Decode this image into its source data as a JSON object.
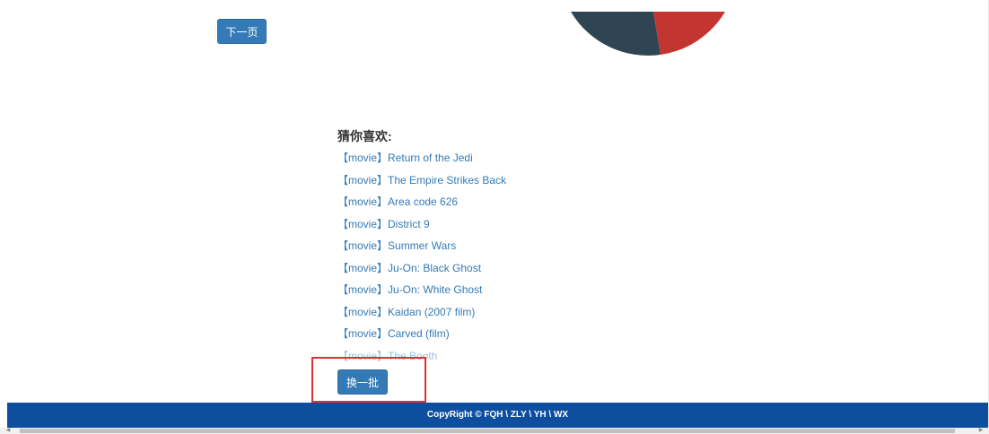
{
  "pagination": {
    "next_label": "下一页"
  },
  "chart": {
    "colors": {
      "dark_slice": "#2f4554",
      "red_slice": "#c23531"
    }
  },
  "recommendations": {
    "title": "猜你喜欢:",
    "items": [
      {
        "tag": "【movie】",
        "title": "Return of the Jedi"
      },
      {
        "tag": "【movie】",
        "title": "The Empire Strikes Back"
      },
      {
        "tag": "【movie】",
        "title": "Area code 626"
      },
      {
        "tag": "【movie】",
        "title": "District 9"
      },
      {
        "tag": "【movie】",
        "title": "Summer Wars"
      },
      {
        "tag": "【movie】",
        "title": "Ju-On: Black Ghost"
      },
      {
        "tag": "【movie】",
        "title": "Ju-On: White Ghost"
      },
      {
        "tag": "【movie】",
        "title": "Kaidan (2007 film)"
      },
      {
        "tag": "【movie】",
        "title": "Carved (film)"
      },
      {
        "tag": "【movie】",
        "title": "The Booth"
      }
    ],
    "refresh_label": "换一批"
  },
  "footer": {
    "copyright": "CopyRight © FQH \\ ZLY \\ YH \\ WX"
  },
  "colors": {
    "primary_button": "#337ab7",
    "footer_bg": "#0d4f9e",
    "highlight": "#e03131"
  }
}
